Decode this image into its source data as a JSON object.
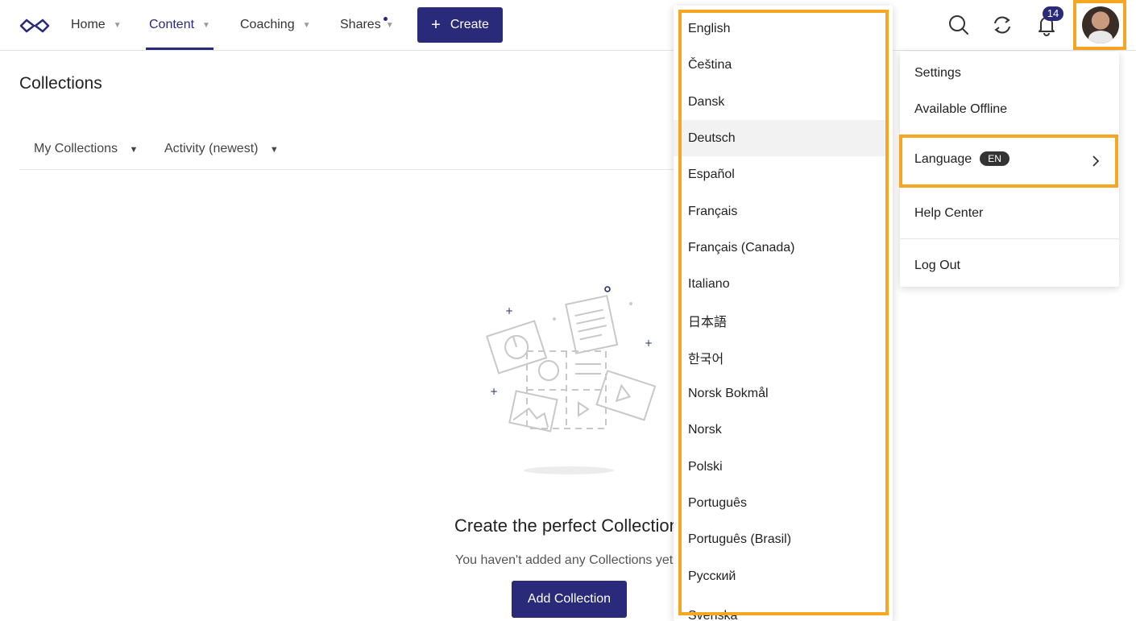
{
  "nav": {
    "items": [
      {
        "label": "Home"
      },
      {
        "label": "Content"
      },
      {
        "label": "Coaching"
      },
      {
        "label": "Shares"
      }
    ],
    "active": "Content",
    "create_label": "Create",
    "notification_count": "14"
  },
  "page": {
    "title": "Collections",
    "filters": [
      {
        "label": "My Collections"
      },
      {
        "label": "Activity (newest)"
      }
    ],
    "empty": {
      "title": "Create the perfect Collection",
      "subtitle": "You haven't added any Collections yet",
      "button_label": "Add Collection"
    }
  },
  "language_menu": {
    "items": [
      "English",
      "Čeština",
      "Dansk",
      "Deutsch",
      "Español",
      "Français",
      "Français (Canada)",
      "Italiano",
      "日本語",
      "한국어",
      "Norsk Bokmål",
      "Norsk",
      "Polski",
      "Português",
      "Português (Brasil)",
      "Русский",
      "Svenska"
    ],
    "hovered": "Deutsch"
  },
  "user_menu": {
    "settings": "Settings",
    "offline": "Available Offline",
    "language": "Language",
    "language_code": "EN",
    "help": "Help Center",
    "logout": "Log Out"
  },
  "colors": {
    "primary": "#2a2a7a",
    "highlight": "#f5a623"
  }
}
